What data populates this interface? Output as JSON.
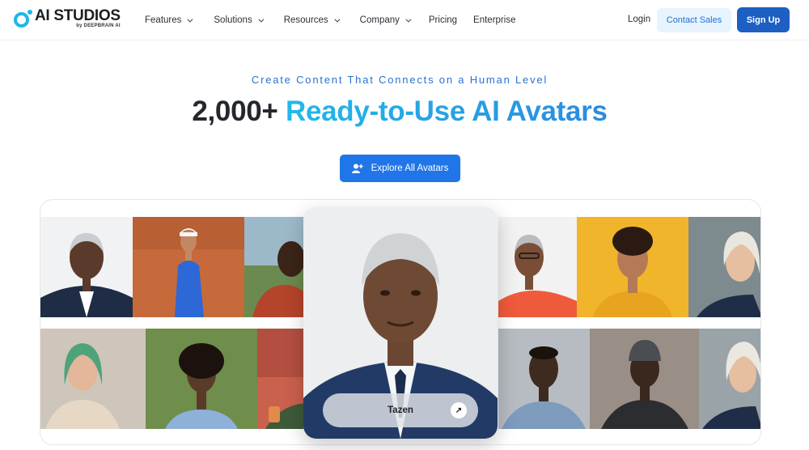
{
  "brand": {
    "name": "AI STUDIOS",
    "sub": "by DEEPBRAIN AI"
  },
  "nav": {
    "items": [
      {
        "label": "Features",
        "dropdown": true
      },
      {
        "label": "Solutions",
        "dropdown": true
      },
      {
        "label": "Resources",
        "dropdown": true
      },
      {
        "label": "Company",
        "dropdown": true
      },
      {
        "label": "Pricing",
        "dropdown": false
      },
      {
        "label": "Enterprise",
        "dropdown": false
      }
    ],
    "login": "Login",
    "contact": "Contact Sales",
    "signup": "Sign Up"
  },
  "hero": {
    "eyebrow": "Create Content That Connects on a Human Level",
    "headline_prefix": "2,000+ ",
    "headline_highlight": "Ready-to-Use AI Avatars",
    "cta": "Explore All Avatars"
  },
  "featured": {
    "name": "Tazen",
    "action_icon": "arrow-up-right-icon"
  },
  "colors": {
    "accent": "#2076e8",
    "brand": "#1fb6e9",
    "signup": "#1d5fc2"
  }
}
